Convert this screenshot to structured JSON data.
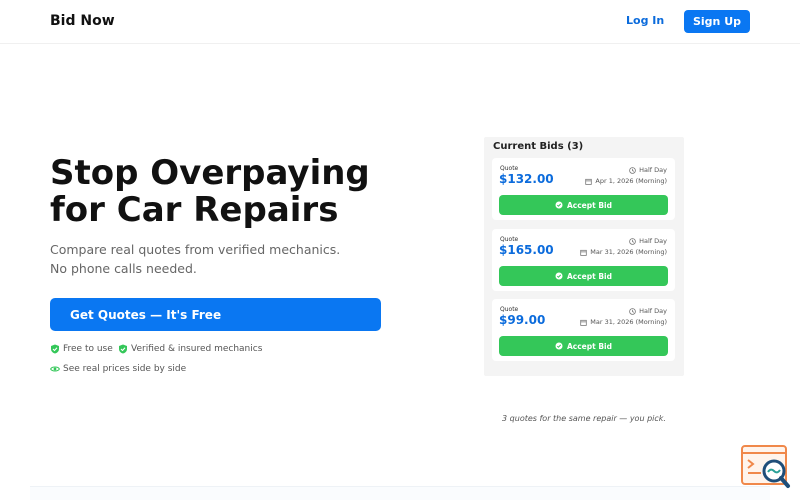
{
  "header": {
    "logo": "Bid Now",
    "login_label": "Log In",
    "signup_label": "Sign Up"
  },
  "hero": {
    "title_line1": "Stop Overpaying",
    "title_line2": "for Car Repairs",
    "subtitle": "Compare real quotes from verified mechanics. No phone calls needed.",
    "cta_label": "Get Quotes — It's Free",
    "features": [
      {
        "icon": "check-shield-icon",
        "label": "Free to use"
      },
      {
        "icon": "check-shield-icon",
        "label": "Verified & insured mechanics"
      },
      {
        "icon": "eye-icon",
        "label": "See real prices side by side"
      }
    ]
  },
  "bids_panel": {
    "title": "Current Bids (3)",
    "quote_label": "Quote",
    "accept_label": "Accept Bid",
    "bids": [
      {
        "price": "$132.00",
        "duration": "Half Day",
        "date": "Apr 1, 2026 (Morning)"
      },
      {
        "price": "$165.00",
        "duration": "Half Day",
        "date": "Mar 31, 2026 (Morning)"
      },
      {
        "price": "$99.00",
        "duration": "Half Day",
        "date": "Mar 31, 2026 (Morning)"
      }
    ],
    "caption": "3 quotes for the same repair — you pick."
  },
  "colors": {
    "primary": "#0a77f2",
    "success": "#34c759",
    "price": "#0b6bdc",
    "widget_accent": "#f0884a"
  }
}
